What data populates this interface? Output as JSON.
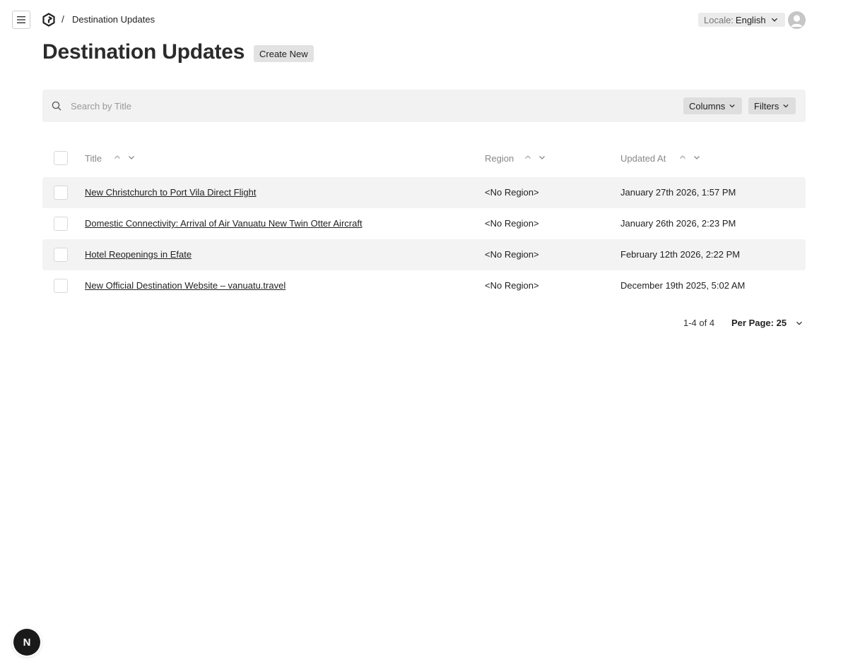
{
  "header": {
    "breadcrumb_separator": "/",
    "breadcrumb": "Destination Updates",
    "locale_label": "Locale:",
    "locale_value": "English"
  },
  "page": {
    "title": "Destination Updates",
    "create_label": "Create New"
  },
  "search": {
    "placeholder": "Search by Title",
    "value": ""
  },
  "toolbar": {
    "columns_label": "Columns",
    "filters_label": "Filters"
  },
  "table": {
    "columns": [
      "Title",
      "Region",
      "Updated At"
    ],
    "rows": [
      {
        "title": "New Christchurch to Port Vila Direct Flight",
        "region": "<No Region>",
        "updated": "January 27th 2026, 1:57 PM"
      },
      {
        "title": "Domestic Connectivity: Arrival of Air Vanuatu New Twin Otter Aircraft",
        "region": "<No Region>",
        "updated": "January 26th 2026, 2:23 PM"
      },
      {
        "title": "Hotel Reopenings in Efate",
        "region": "<No Region>",
        "updated": "February 12th 2026, 2:22 PM"
      },
      {
        "title": "New Official Destination Website – vanuatu.travel",
        "region": "<No Region>",
        "updated": "December 19th 2025, 5:02 AM"
      }
    ]
  },
  "pagination": {
    "range": "1-4 of 4",
    "per_page": "Per Page: 25"
  },
  "dev_badge": "N",
  "icons": {
    "menu": "hamburger-menu-icon",
    "logo": "payload-logo-icon",
    "search": "search-icon",
    "chevron": "chevron-down-icon",
    "sort_asc": "chevron-up-icon",
    "sort_desc": "chevron-down-icon",
    "avatar": "user-avatar-icon"
  },
  "colors": {
    "row_shade": "#f3f3f3",
    "search_bg": "#f2f2f2",
    "pill_bg": "#dedede",
    "badge_bg": "#1a1a1a"
  }
}
